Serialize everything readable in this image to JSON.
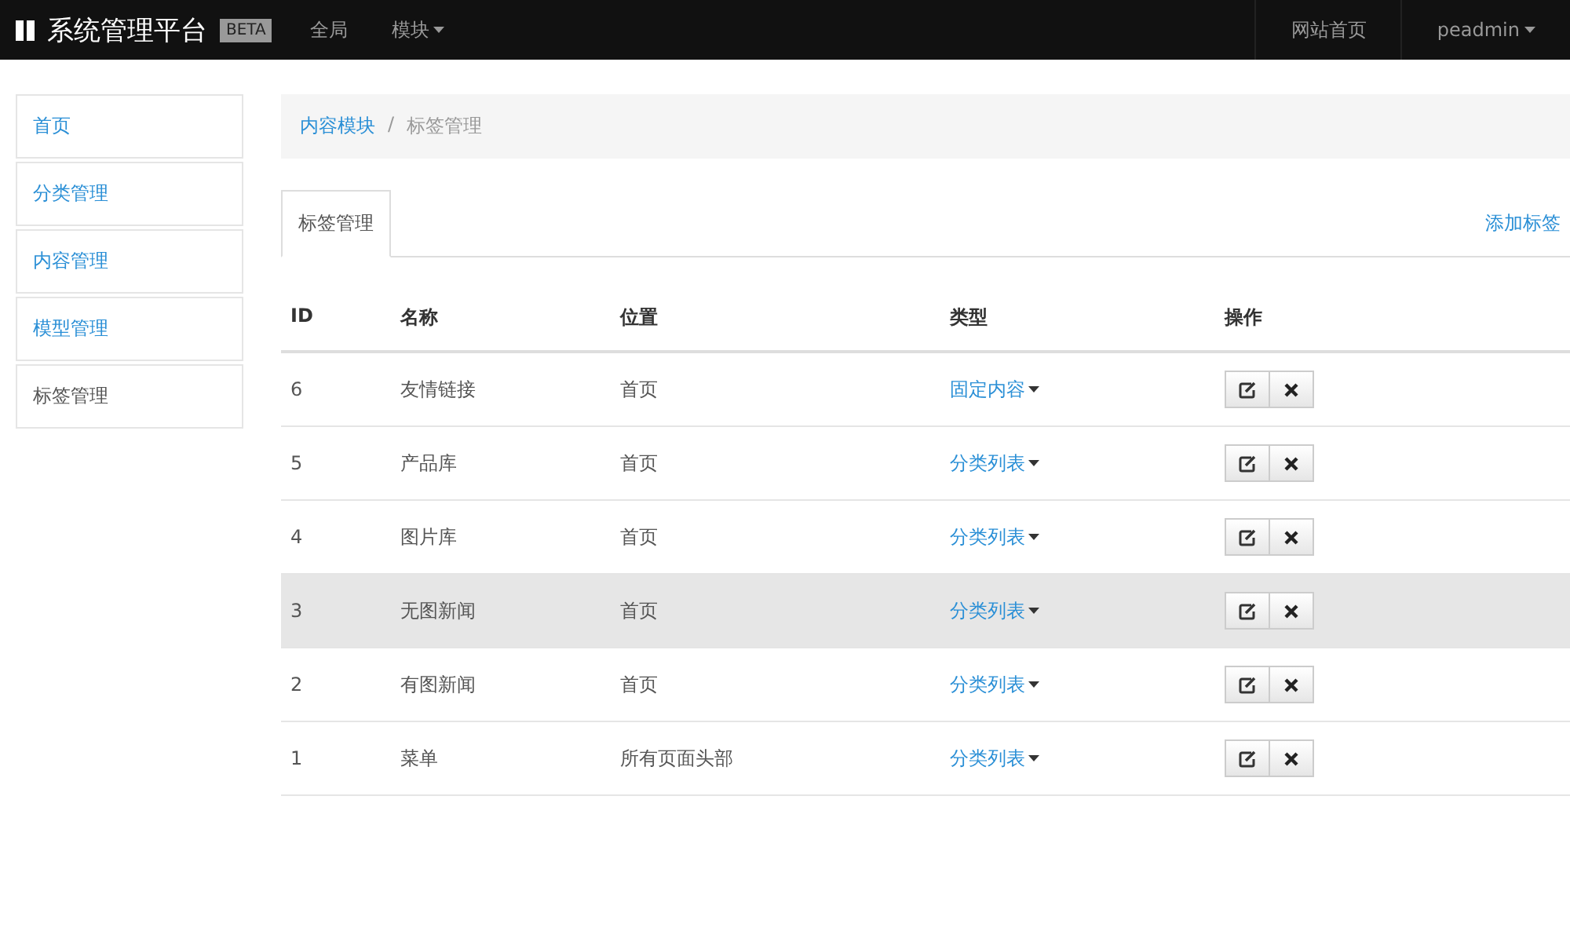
{
  "navbar": {
    "brand": "系统管理平台",
    "badge": "BETA",
    "menu": [
      {
        "label": "全局",
        "dropdown": false
      },
      {
        "label": "模块",
        "dropdown": true
      }
    ],
    "right": [
      {
        "label": "网站首页",
        "dropdown": false
      },
      {
        "label": "peadmin",
        "dropdown": true
      }
    ]
  },
  "sidebar": {
    "items": [
      {
        "label": "首页",
        "selected": false
      },
      {
        "label": "分类管理",
        "selected": false
      },
      {
        "label": "内容管理",
        "selected": false
      },
      {
        "label": "模型管理",
        "selected": false
      },
      {
        "label": "标签管理",
        "selected": true
      }
    ]
  },
  "breadcrumb_separator": "/",
  "breadcrumb": [
    {
      "label": "内容模块",
      "link": true
    },
    {
      "label": "标签管理",
      "link": false
    }
  ],
  "tabs": [
    {
      "label": "标签管理",
      "selected": true
    }
  ],
  "add_link": "添加标签",
  "table": {
    "columns": [
      "ID",
      "名称",
      "位置",
      "类型",
      "操作"
    ],
    "rows": [
      {
        "id": "6",
        "name": "友情链接",
        "position": "首页",
        "type": "固定内容",
        "highlighted": false
      },
      {
        "id": "5",
        "name": "产品库",
        "position": "首页",
        "type": "分类列表",
        "highlighted": false
      },
      {
        "id": "4",
        "name": "图片库",
        "position": "首页",
        "type": "分类列表",
        "highlighted": false
      },
      {
        "id": "3",
        "name": "无图新闻",
        "position": "首页",
        "type": "分类列表",
        "highlighted": true
      },
      {
        "id": "2",
        "name": "有图新闻",
        "position": "首页",
        "type": "分类列表",
        "highlighted": false
      },
      {
        "id": "1",
        "name": "菜单",
        "position": "所有页面头部",
        "type": "分类列表",
        "highlighted": false
      }
    ]
  }
}
